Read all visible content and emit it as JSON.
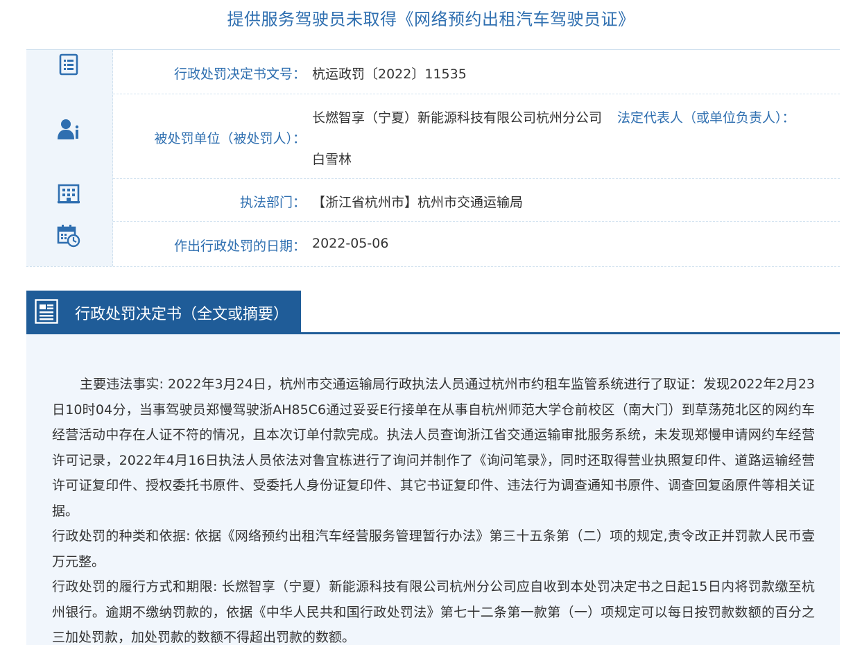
{
  "page": {
    "title": "提供服务驾驶员未取得《网络预约出租汽车驾驶员证》"
  },
  "info": {
    "doc_no_label": "行政处罚决定书文号：",
    "doc_no_value": "杭运政罚〔2022〕11535",
    "party_label": "被处罚单位（被处罚人）：",
    "party_company": "长燃智享（宁夏）新能源科技有限公司杭州分公司",
    "legal_rep_label": "法定代表人（或单位负责人）：",
    "legal_rep_value": "白雪林",
    "dept_label": "执法部门：",
    "dept_value": "【浙江省杭州市】杭州市交通运输局",
    "date_label": "作出行政处罚的日期：",
    "date_value": "2022-05-06"
  },
  "icons": {
    "row1": "document-list-icon",
    "row2": "person-info-icon",
    "row3": "building-icon",
    "row4": "calendar-clock-icon",
    "section": "document-icon"
  },
  "colors": {
    "accent": "#2f6fb0",
    "tab_bg": "#1f5c98",
    "icon_col_bg": "#eff5fb",
    "content_bg": "#f1f6fc"
  },
  "section": {
    "title": "行政处罚决定书（全文或摘要）"
  },
  "content": {
    "facts": "主要违法事实: 2022年3月24日，杭州市交通运输局行政执法人员通过杭州市约租车监管系统进行了取证：发现2022年2月23日10时04分，当事驾驶员郑慢驾驶浙AH85C6通过妥妥E行接单在从事自杭州师范大学仓前校区（南大门）到草荡苑北区的网约车经营活动中存在人证不符的情况，且本次订单付款完成。执法人员查询浙江省交通运输审批服务系统，未发现郑慢申请网约车经营许可记录，2022年4月16日执法人员依法对鲁宜栋进行了询问并制作了《询问笔录》，同时还取得营业执照复印件、道路运输经营许可证复印件、授权委托书原件、受委托人身份证复印件、其它书证复印件、违法行为调查通知书原件、调查回复函原件等相关证据。",
    "basis": "行政处罚的种类和依据: 依据《网络预约出租汽车经营服务管理暂行办法》第三十五条第（二）项的规定,责令改正并罚款人民币壹万元整。",
    "execution": "行政处罚的履行方式和期限: 长燃智享（宁夏）新能源科技有限公司杭州分公司应自收到本处罚决定书之日起15日内将罚款缴至杭州银行。逾期不缴纳罚款的，依据《中华人民共和国行政处罚法》第七十二条第一款第（一）项规定可以每日按罚款数额的百分之三加处罚款，加处罚款的数额不得超出罚款的数额。"
  }
}
